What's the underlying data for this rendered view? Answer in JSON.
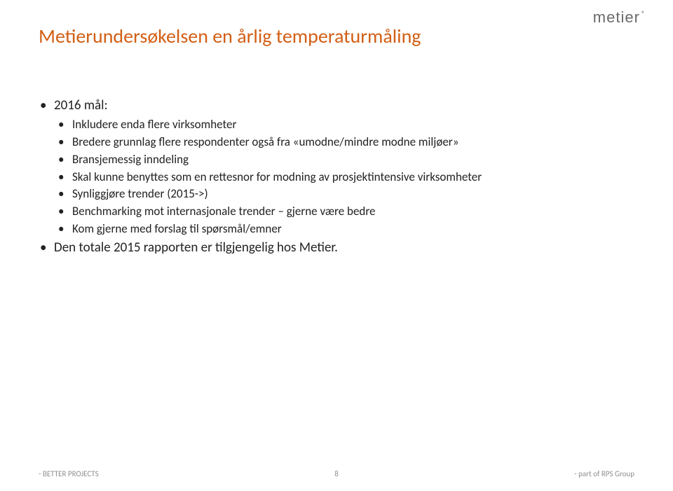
{
  "brand": {
    "name": "metier",
    "reg": "®"
  },
  "title": "Metierundersøkelsen en årlig temperaturmåling",
  "top": {
    "heading": "2016 mål:",
    "items": [
      "Inkludere enda flere virksomheter",
      "Bredere grunnlag flere respondenter også fra «umodne/mindre modne miljøer»",
      "Bransjemessig inndeling",
      "Skal kunne benyttes som en rettesnor for modning av prosjektintensive virksomheter",
      "Synliggjøre trender (2015->)",
      "Benchmarking mot internasjonale trender – gjerne være bedre",
      "Kom gjerne med forslag til spørsmål/emner"
    ],
    "final": "Den totale 2015 rapporten er tilgjengelig hos Metier."
  },
  "footer": {
    "left": "- BETTER PROJECTS",
    "center": "8",
    "right": "- part of RPS Group"
  }
}
